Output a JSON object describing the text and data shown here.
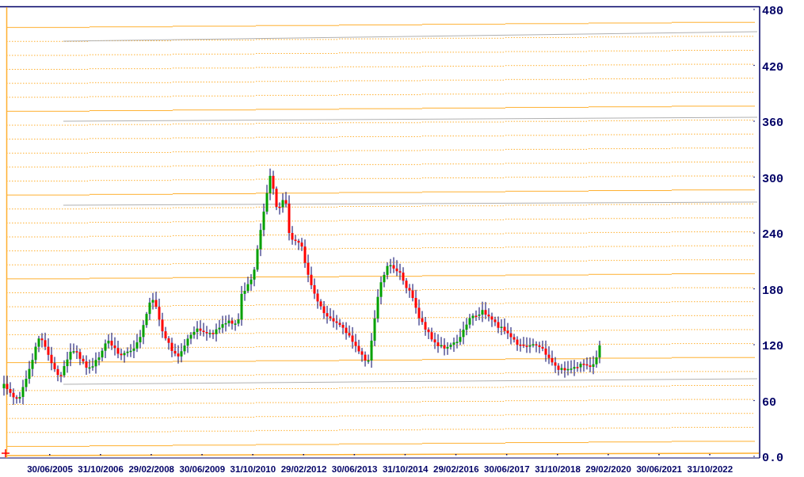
{
  "chart": {
    "y_axis_labels": [
      "480",
      "420",
      "360",
      "300",
      "240",
      "180",
      "120",
      "60",
      "0.0"
    ],
    "x_axis_labels": [
      "30/06/2005",
      "31/10/2006",
      "29/02/2008",
      "30/06/2009",
      "31/10/2010",
      "29/02/2012",
      "30/06/2013",
      "31/10/2014",
      "29/02/2016",
      "30/06/2017",
      "31/10/2018",
      "29/02/2020",
      "30/06/2021",
      "31/10/2022"
    ]
  }
}
